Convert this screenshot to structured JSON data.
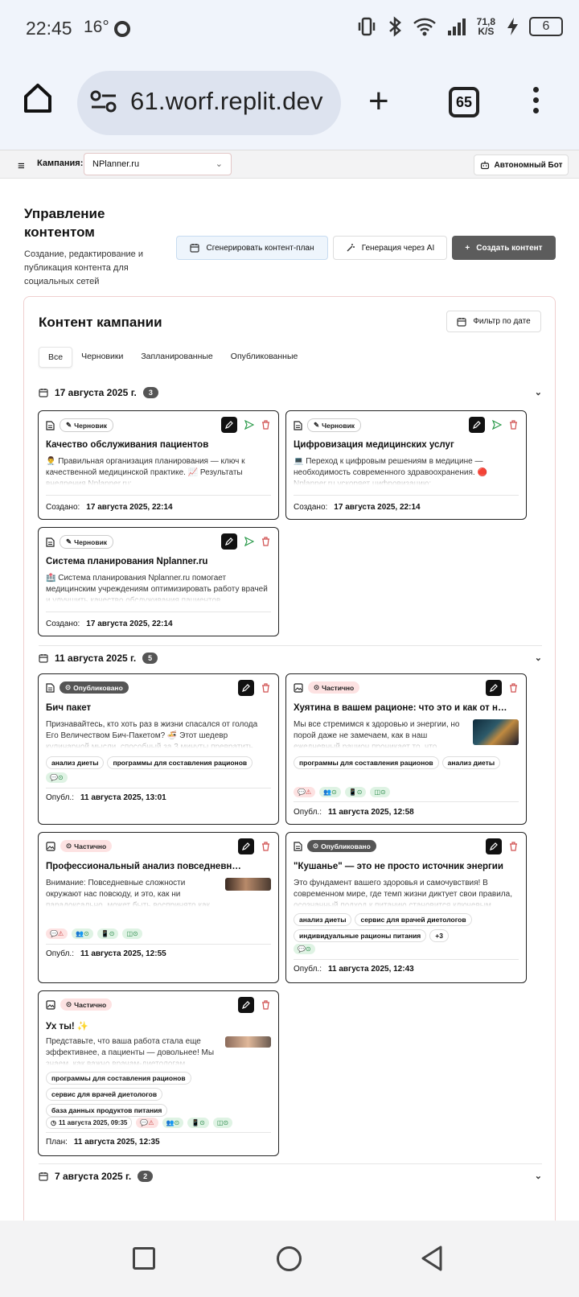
{
  "status": {
    "time": "22:45",
    "temp": "16°",
    "speed_top": "71,8",
    "speed_bottom": "K/S",
    "battery": "6"
  },
  "browser": {
    "url": "61.worf.replit.dev",
    "tabs_count": "65"
  },
  "appbar": {
    "campaign_label": "Кампания:",
    "campaign_value": "NPlanner.ru",
    "bot_button": "Автономный Бот"
  },
  "header": {
    "title": "Управление контентом",
    "subtitle": "Создание, редактирование и публикация контента для социальных сетей",
    "btn_generate": "Сгенерировать контент-план",
    "btn_ai": "Генерация через AI",
    "btn_create": "Создать контент"
  },
  "panel": {
    "title": "Контент кампании",
    "filter": "Фильтр по дате",
    "tabs": [
      "Все",
      "Черновики",
      "Запланированные",
      "Опубликованные"
    ]
  },
  "groups": [
    {
      "date": "17 августа 2025 г.",
      "count": "3",
      "cards": [
        {
          "badge": "Черновик",
          "title": "Качество обслуживания пациентов",
          "text": "👨‍⚕️ Правильная организация планирования — ключ к качественной медицинской практике. 📈 Результаты внедрения Nplanner.ru:",
          "foot_label": "Создано:",
          "foot_value": "17 августа 2025, 22:14"
        },
        {
          "badge": "Черновик",
          "title": "Цифровизация медицинских услуг",
          "text": "💻 Переход к цифровым решениям в медицине — необходимость современного здравоохранения. 🔴 Nplanner.ru ускоряет цифровизацию:",
          "foot_label": "Создано:",
          "foot_value": "17 августа 2025, 22:14"
        },
        {
          "badge": "Черновик",
          "title": "Система планирования Nplanner.ru",
          "text": "🏥 Система планирования Nplanner.ru помогает медицинским учреждениям оптимизировать работу врачей и улучшить качество обслуживания пациентов",
          "foot_label": "Создано:",
          "foot_value": "17 августа 2025, 22:14"
        }
      ]
    },
    {
      "date": "11 августа 2025 г.",
      "count": "5",
      "cards": [
        {
          "badge": "Опубликовано",
          "title": "Бич пакет",
          "text": "Признавайтесь, кто хоть раз в жизни спасался от голода Его Величеством Бич-Пакетом? 🍜 Этот шедевр кулинарной мысли, способный за 3 минуты превратить",
          "tags": [
            "анализ диеты",
            "программы для составления рационов"
          ],
          "foot_label": "Опубл.:",
          "foot_value": "11 августа 2025, 13:01"
        },
        {
          "badge": "Частично",
          "title": "Хуятина в вашем рационе: что это и как от неё избавиться",
          "text": "Мы все стремимся к здоровью и энергии, но порой даже не замечаем, как в наш ежедневный рацион проникает то, что",
          "tags": [
            "программы для составления рационов",
            "анализ диеты"
          ],
          "foot_label": "Опубл.:",
          "foot_value": "11 августа 2025, 12:58"
        },
        {
          "badge": "Частично",
          "title": "Профессиональный анализ повседневных сложностей",
          "text": "Внимание: Повседневные сложности окружают нас повсюду, и это, как ни парадоксально, может быть воспринято как",
          "foot_label": "Опубл.:",
          "foot_value": "11 августа 2025, 12:55"
        },
        {
          "badge": "Опубликовано",
          "title": "\"Кушанье\" — это не просто источник энергии",
          "text": "Это фундамент вашего здоровья и самочувствия! В современном мире, где темп жизни диктует свои правила, осознанный подход к питанию становится ключевым",
          "tags": [
            "анализ диеты",
            "сервис для врачей диетологов",
            "индивидуальные рационы питания",
            "+3"
          ],
          "foot_label": "Опубл.:",
          "foot_value": "11 августа 2025, 12:43"
        },
        {
          "badge": "Частично",
          "title": "Ух ты! ✨",
          "text": "Представьте, что ваша работа стала еще эффективнее, а пациенты — довольнее! Мы знаем, как важно врачам-диетологам",
          "tags": [
            "программы для составления рационов",
            "сервис для врачей диетологов",
            "база данных продуктов питания"
          ],
          "time_chip": "11 августа 2025, 09:35",
          "foot_label": "План:",
          "foot_value": "11 августа 2025, 12:35"
        }
      ]
    },
    {
      "date": "7 августа 2025 г.",
      "count": "2"
    }
  ],
  "colors": {
    "accent": "#111111",
    "published_badge": "#555555",
    "partial_badge": "#fde2e2",
    "ok": "#dff3e4",
    "send": "#2a9a4a",
    "delete": "#d05050"
  }
}
